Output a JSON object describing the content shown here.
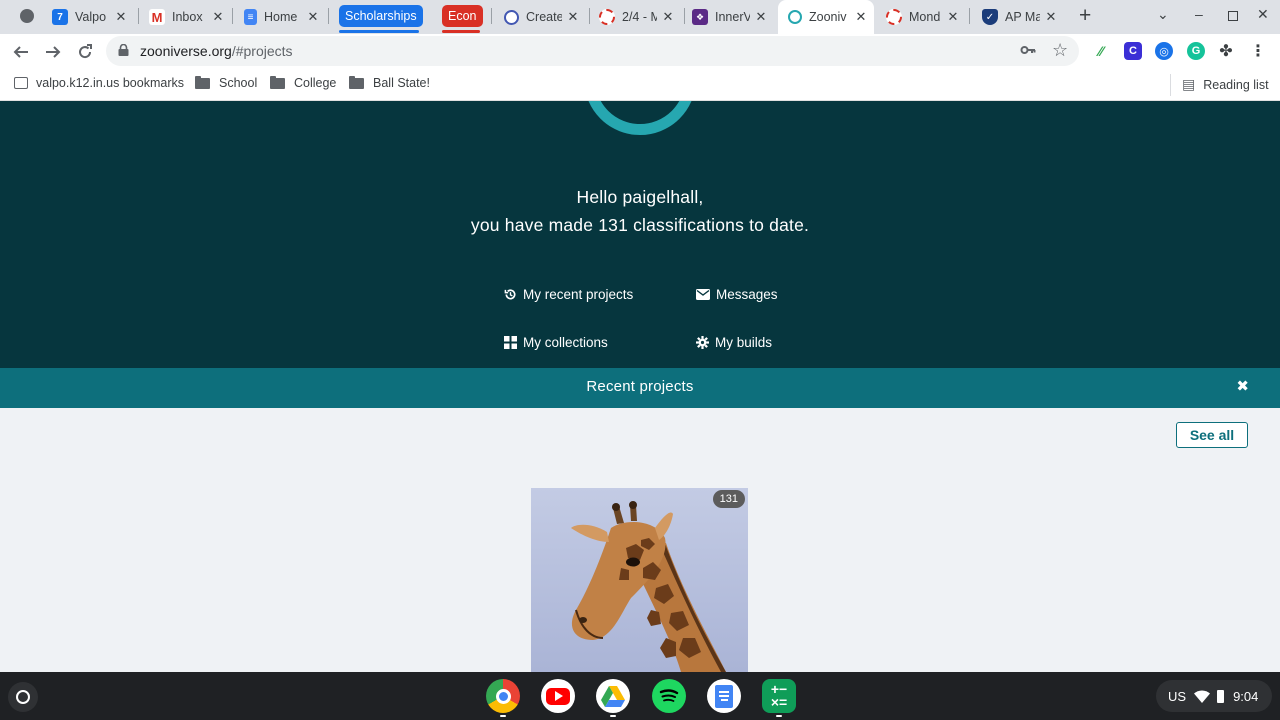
{
  "browser": {
    "tabs": [
      {
        "title": "Valpo",
        "icon": "calendar-icon"
      },
      {
        "title": "Inbox",
        "icon": "gmail-icon"
      },
      {
        "title": "Home",
        "icon": "docs-icon"
      },
      {
        "title": "Create",
        "icon": "quizlet-icon"
      },
      {
        "title": "2/4 - M",
        "icon": "loading-icon"
      },
      {
        "title": "InnerV",
        "icon": "innerview-icon"
      },
      {
        "title": "Zooniv",
        "icon": "zooniverse-icon",
        "active": true
      },
      {
        "title": "Mond",
        "icon": "loading-icon"
      },
      {
        "title": "AP Ma",
        "icon": "shield-icon"
      }
    ],
    "tab_groups": [
      {
        "label": "Scholarships",
        "color": "#1a73e8"
      },
      {
        "label": "Econ",
        "color": "#d93025"
      }
    ],
    "address": {
      "domain": "zooniverse.org",
      "path": "/#projects"
    },
    "bookmarks": [
      {
        "label": "valpo.k12.in.us bookmarks"
      },
      {
        "label": "School"
      },
      {
        "label": "College"
      },
      {
        "label": "Ball State!"
      }
    ],
    "reading_list": "Reading list"
  },
  "page": {
    "greeting_line1": "Hello paigelhall,",
    "greeting_line2": "you have made 131 classifications to date.",
    "links": {
      "recent": "My recent projects",
      "messages": "Messages",
      "collections": "My collections",
      "builds": "My builds"
    },
    "recent_title": "Recent projects",
    "close_symbol": "✖",
    "see_all": "See all",
    "project_badge": "131"
  },
  "system": {
    "locale": "US",
    "time": "9:04"
  },
  "colors": {
    "hero": "#06363e",
    "accent": "#0d6f7c",
    "ring": "#26a7b0"
  }
}
